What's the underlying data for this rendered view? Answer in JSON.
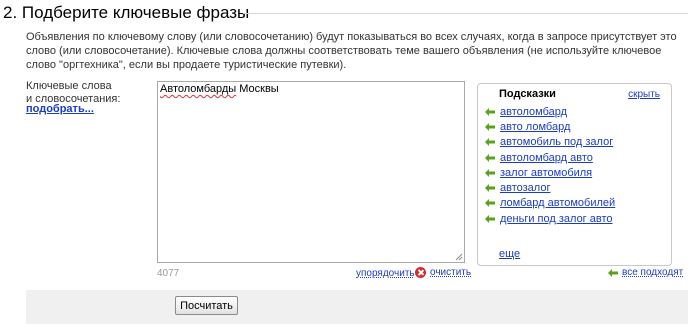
{
  "section": {
    "title": "2. Подберите ключевые фразы",
    "description": "Объявления по ключевому слову (или словосочетанию) будут показываться во всех случаях, когда в запросе присутствует это слово (или словосочетание). Ключевые слова должны соответствовать теме вашего объявления (не используйте ключевое слово \"оргтехника\", если вы продаете туристические путевки)."
  },
  "keywords": {
    "label_line1": "Ключевые слова",
    "label_line2": "и словосочетания:",
    "pick_link": "подобрать...",
    "value_word1": "Автоломбарды",
    "value_word2": " Москвы",
    "counter": "4077",
    "order_link": "упорядочить",
    "clear_link": "очистить"
  },
  "hints": {
    "title": "Подсказки",
    "hide_link": "скрыть",
    "items": [
      "автоломбард",
      "авто ломбард",
      "автомобиль под залог",
      "автоломбард авто",
      "залог автомобиля",
      "автозалог",
      "ломбард автомобилей",
      "деньги под залог авто"
    ],
    "more_link": "еще",
    "all_fit_link": "все подходят"
  },
  "actions": {
    "calc_button": "Посчитать"
  },
  "colors": {
    "link": "#1a3dc1",
    "arrow": "#5aa21e",
    "clear_icon": "#d42a2a"
  }
}
